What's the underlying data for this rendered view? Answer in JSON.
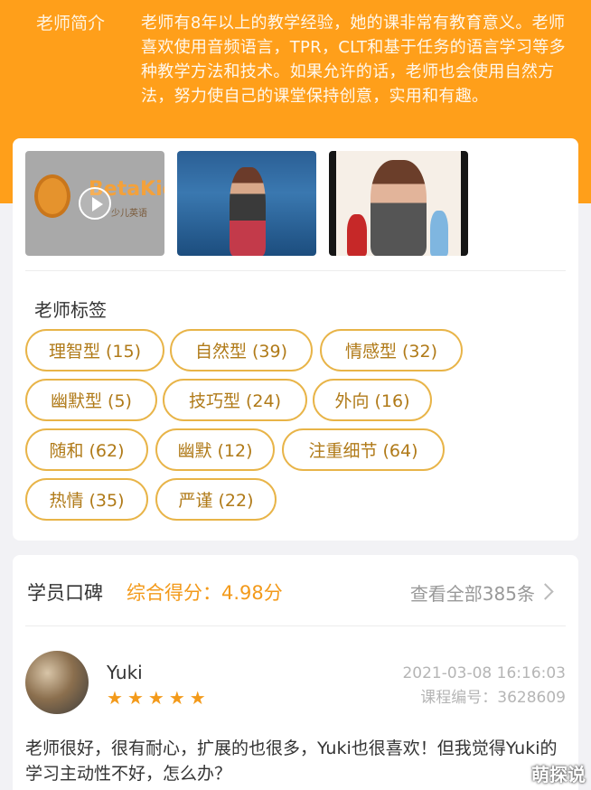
{
  "intro": {
    "label": "老师简介",
    "text": "老师有8年以上的教学经验，她的课非常有教育意义。老师喜欢使用音频语言，TPR，CLT和基于任务的语言学习等多种教学方法和技术。如果允许的话，老师也会使用自然方法，努力使自己的课堂保持创意，实用和有趣。"
  },
  "media": {
    "brand": "BetaKid",
    "brand_sub": "少儿英语"
  },
  "tags": {
    "title": "老师标签",
    "items": [
      {
        "label": "理智型 (15)"
      },
      {
        "label": "自然型 (39)"
      },
      {
        "label": "情感型 (32)"
      },
      {
        "label": "幽默型 (5)"
      },
      {
        "label": "技巧型 (24)"
      },
      {
        "label": "外向 (16)"
      },
      {
        "label": "随和 (62)"
      },
      {
        "label": "幽默 (12)"
      },
      {
        "label": "注重细节 (64)"
      },
      {
        "label": "热情 (35)"
      },
      {
        "label": "严谨 (22)"
      }
    ]
  },
  "reviews": {
    "title": "学员口碑",
    "score_label": "综合得分：4.98分",
    "view_all": "查看全部385条",
    "items": [
      {
        "name": "Yuki",
        "rating": 5,
        "time": "2021-03-08 16:16:03",
        "course_no": "课程编号：3628609",
        "body": "老师很好，很有耐心，扩展的也很多，Yuki也很喜欢！但我觉得Yuki的学习主动性不好，怎么办？"
      }
    ]
  },
  "watermark": "萌探说",
  "colors": {
    "brand_orange": "#ff9f1a",
    "tag_border": "#e8b448",
    "star": "#f39a1a"
  }
}
